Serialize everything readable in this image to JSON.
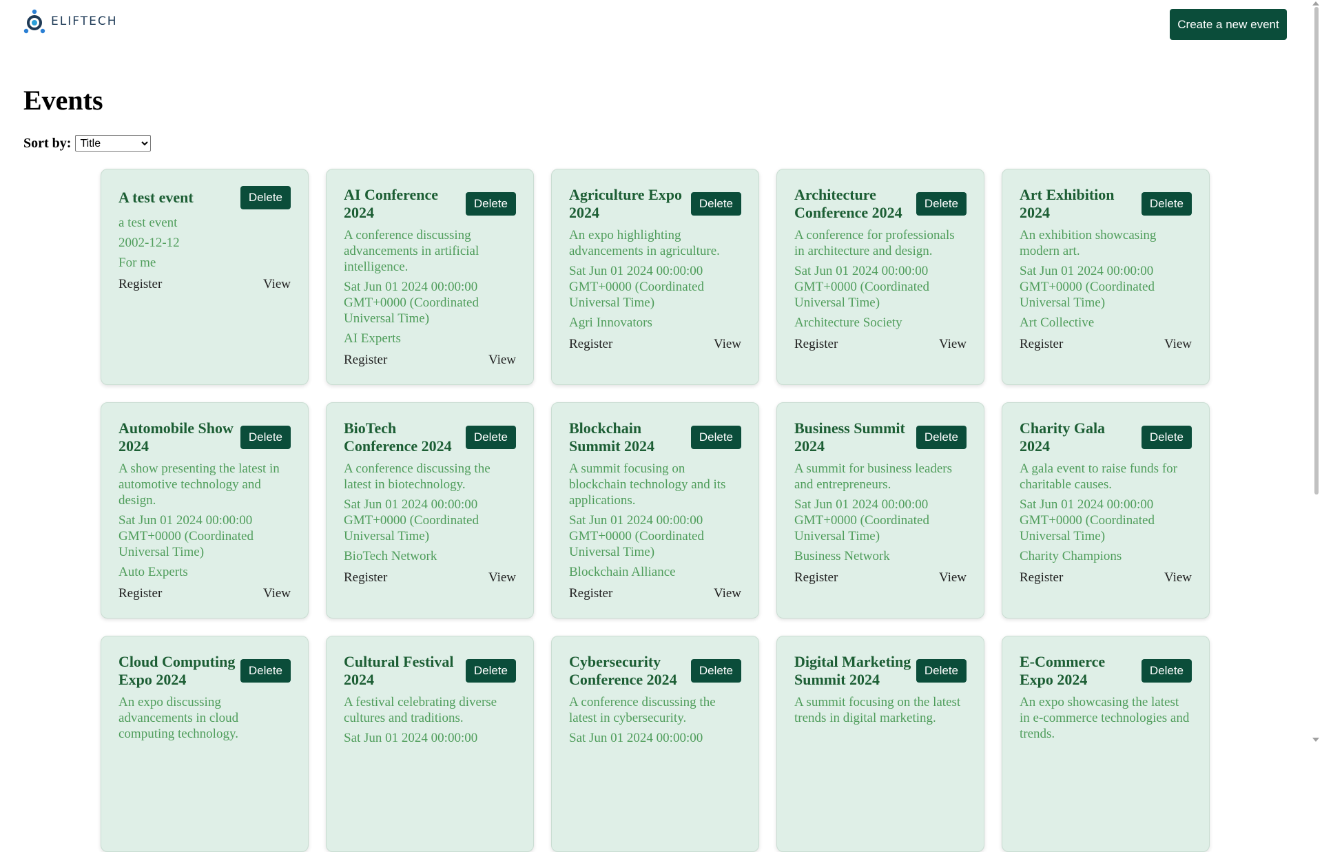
{
  "header": {
    "logo_text": "ELIFTECH",
    "create_button": "Create a new event"
  },
  "page": {
    "title": "Events",
    "sort_label": "Sort by:",
    "sort_value": "Title"
  },
  "card_actions": {
    "delete": "Delete",
    "register": "Register",
    "view": "View"
  },
  "events": [
    {
      "title": "A test event",
      "description": "a test event",
      "date": "2002-12-12",
      "organizer": "For me"
    },
    {
      "title": "AI Conference 2024",
      "description": "A conference discussing advancements in artificial intelligence.",
      "date": "Sat Jun 01 2024 00:00:00 GMT+0000 (Coordinated Universal Time)",
      "organizer": "AI Experts"
    },
    {
      "title": "Agriculture Expo 2024",
      "description": "An expo highlighting advancements in agriculture.",
      "date": "Sat Jun 01 2024 00:00:00 GMT+0000 (Coordinated Universal Time)",
      "organizer": "Agri Innovators"
    },
    {
      "title": "Architecture Conference 2024",
      "description": "A conference for professionals in architecture and design.",
      "date": "Sat Jun 01 2024 00:00:00 GMT+0000 (Coordinated Universal Time)",
      "organizer": "Architecture Society"
    },
    {
      "title": "Art Exhibition 2024",
      "description": "An exhibition showcasing modern art.",
      "date": "Sat Jun 01 2024 00:00:00 GMT+0000 (Coordinated Universal Time)",
      "organizer": "Art Collective"
    },
    {
      "title": "Automobile Show 2024",
      "description": "A show presenting the latest in automotive technology and design.",
      "date": "Sat Jun 01 2024 00:00:00 GMT+0000 (Coordinated Universal Time)",
      "organizer": "Auto Experts"
    },
    {
      "title": "BioTech Conference 2024",
      "description": "A conference discussing the latest in biotechnology.",
      "date": "Sat Jun 01 2024 00:00:00 GMT+0000 (Coordinated Universal Time)",
      "organizer": "BioTech Network"
    },
    {
      "title": "Blockchain Summit 2024",
      "description": "A summit focusing on blockchain technology and its applications.",
      "date": "Sat Jun 01 2024 00:00:00 GMT+0000 (Coordinated Universal Time)",
      "organizer": "Blockchain Alliance"
    },
    {
      "title": "Business Summit 2024",
      "description": "A summit for business leaders and entrepreneurs.",
      "date": "Sat Jun 01 2024 00:00:00 GMT+0000 (Coordinated Universal Time)",
      "organizer": "Business Network"
    },
    {
      "title": "Charity Gala 2024",
      "description": "A gala event to raise funds for charitable causes.",
      "date": "Sat Jun 01 2024 00:00:00 GMT+0000 (Coordinated Universal Time)",
      "organizer": "Charity Champions"
    },
    {
      "title": "Cloud Computing Expo 2024",
      "description": "An expo discussing advancements in cloud computing technology.",
      "date": "",
      "organizer": ""
    },
    {
      "title": "Cultural Festival 2024",
      "description": "A festival celebrating diverse cultures and traditions.",
      "date": "Sat Jun 01 2024 00:00:00",
      "organizer": ""
    },
    {
      "title": "Cybersecurity Conference 2024",
      "description": "A conference discussing the latest in cybersecurity.",
      "date": "Sat Jun 01 2024 00:00:00",
      "organizer": ""
    },
    {
      "title": "Digital Marketing Summit 2024",
      "description": "A summit focusing on the latest trends in digital marketing.",
      "date": "",
      "organizer": ""
    },
    {
      "title": "E-Commerce Expo 2024",
      "description": "An expo showcasing the latest in e-commerce technologies and trends.",
      "date": "",
      "organizer": ""
    }
  ]
}
